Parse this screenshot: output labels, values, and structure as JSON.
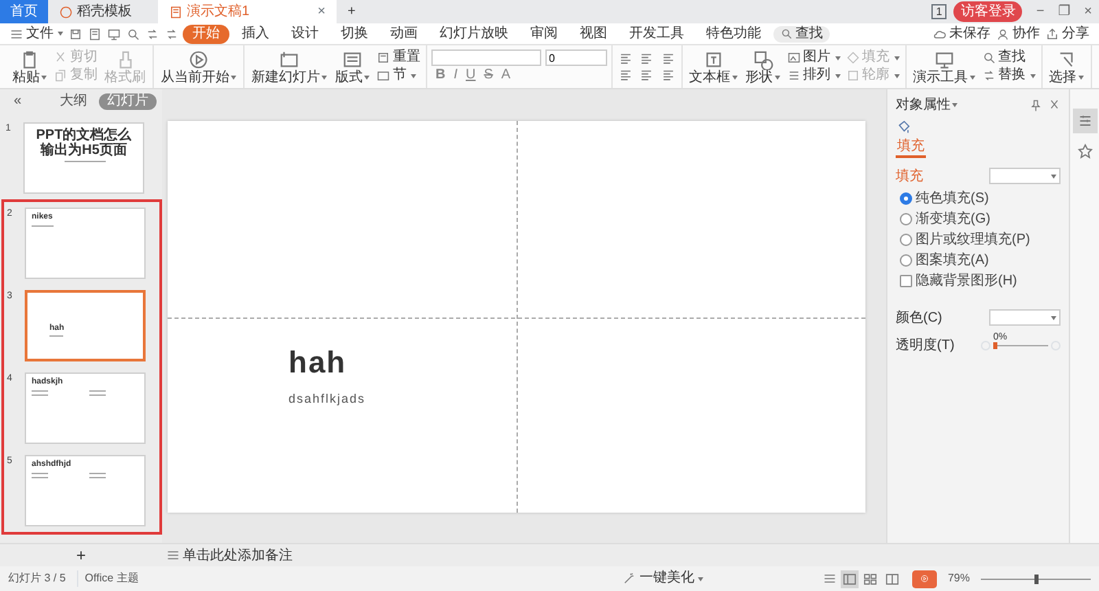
{
  "doc_tabs": [
    {
      "label": "首页",
      "kind": "home",
      "selected": false
    },
    {
      "label": "稻壳模板",
      "kind": "store",
      "selected": false
    },
    {
      "label": "演示文稿1",
      "kind": "doc",
      "selected": true
    }
  ],
  "tab_close": "×",
  "new_tab": "+",
  "account": {
    "badge": "1",
    "login": "访客登录"
  },
  "window_controls": [
    "−",
    "❐",
    "×"
  ],
  "menu": {
    "file": "文件",
    "tabs": [
      {
        "label": "开始",
        "selected": true
      },
      {
        "label": "插入",
        "selected": false
      },
      {
        "label": "设计",
        "selected": false
      },
      {
        "label": "切换",
        "selected": false
      },
      {
        "label": "动画",
        "selected": false
      },
      {
        "label": "幻灯片放映",
        "selected": false
      },
      {
        "label": "审阅",
        "selected": false
      },
      {
        "label": "视图",
        "selected": false
      },
      {
        "label": "开发工具",
        "selected": false
      },
      {
        "label": "特色功能",
        "selected": false
      }
    ],
    "search": "查找",
    "actions": [
      "未保存",
      "协作",
      "分享"
    ]
  },
  "toolbar": [
    {
      "kind": "tools",
      "items": [
        {
          "kind": "large",
          "label": "粘贴",
          "caret": true,
          "disabled": false
        },
        {
          "kind": "small",
          "label": "剪切",
          "caret": false,
          "disabled": true
        },
        {
          "kind": "small",
          "label": "复制",
          "caret": false,
          "disabled": true
        },
        {
          "kind": "large",
          "label": "格式刷",
          "caret": false,
          "disabled": true
        }
      ]
    },
    {
      "kind": "tools",
      "items": [
        {
          "kind": "large",
          "label": "从当前开始",
          "caret": true,
          "disabled": false
        }
      ]
    },
    {
      "kind": "tools",
      "items": [
        {
          "kind": "large",
          "label": "新建幻灯片",
          "caret": true,
          "disabled": false
        },
        {
          "kind": "large",
          "label": "版式",
          "caret": true,
          "disabled": false
        },
        {
          "kind": "small",
          "label": "重置",
          "caret": false,
          "disabled": false
        },
        {
          "kind": "small",
          "label": "节",
          "caret": true,
          "disabled": false
        }
      ]
    },
    {
      "kind": "font",
      "font_size": "0",
      "format": [
        "B",
        "I",
        "U",
        "S",
        "A"
      ]
    },
    {
      "kind": "paragraph"
    },
    {
      "kind": "tools",
      "items": [
        {
          "kind": "large",
          "label": "文本框",
          "caret": true,
          "disabled": false
        },
        {
          "kind": "large",
          "label": "形状",
          "caret": true,
          "disabled": false
        },
        {
          "kind": "small",
          "label": "图片",
          "caret": true,
          "disabled": false
        },
        {
          "kind": "small",
          "label": "排列",
          "caret": true,
          "disabled": false
        },
        {
          "kind": "small",
          "label": "填充",
          "caret": true,
          "disabled": true
        },
        {
          "kind": "small",
          "label": "轮廓",
          "caret": true,
          "disabled": true
        }
      ]
    },
    {
      "kind": "tools",
      "items": [
        {
          "kind": "large",
          "label": "演示工具",
          "caret": true,
          "disabled": false
        },
        {
          "kind": "small",
          "label": "查找",
          "caret": false,
          "disabled": false
        },
        {
          "kind": "small",
          "label": "替换",
          "caret": true,
          "disabled": false
        }
      ]
    },
    {
      "kind": "tools",
      "items": [
        {
          "kind": "large",
          "label": "选择",
          "caret": true,
          "disabled": false
        }
      ]
    }
  ],
  "left_panel": {
    "collapse": "«",
    "tabs": [
      {
        "label": "大纲",
        "selected": false
      },
      {
        "label": "幻灯片",
        "selected": true
      }
    ],
    "slides": [
      {
        "number": "1",
        "title": "PPT的文档怎么输出为H5页面",
        "kind": "title",
        "selected": false,
        "highlighted": false
      },
      {
        "number": "2",
        "title": "nikes",
        "kind": "heading",
        "selected": false,
        "highlighted": true
      },
      {
        "number": "3",
        "title": "hah",
        "kind": "center",
        "selected": true,
        "highlighted": true
      },
      {
        "number": "4",
        "title": "hadskjh",
        "kind": "two_column",
        "selected": false,
        "highlighted": true
      },
      {
        "number": "5",
        "title": "ahshdfhjd",
        "kind": "two_column",
        "selected": false,
        "highlighted": true
      }
    ],
    "add": "+"
  },
  "slide": {
    "title": "hah",
    "subtitle": "dsahflkjads"
  },
  "notes": "单击此处添加备注",
  "properties": {
    "title": "对象属性",
    "tab": {
      "label": "填充",
      "selected": true
    },
    "section": "填充",
    "options": [
      {
        "kind": "radio",
        "label": "纯色填充(S)",
        "checked": true
      },
      {
        "kind": "radio",
        "label": "渐变填充(G)",
        "checked": false
      },
      {
        "kind": "radio",
        "label": "图片或纹理填充(P)",
        "checked": false
      },
      {
        "kind": "radio",
        "label": "图案填充(A)",
        "checked": false
      },
      {
        "kind": "checkbox",
        "label": "隐藏背景图形(H)",
        "checked": false
      }
    ],
    "color_label": "颜色(C)",
    "transparency_label": "透明度(T)",
    "transparency": {
      "reading": "0%",
      "level": 0
    }
  },
  "side_strip": [
    {
      "kind": "properties",
      "selected": true
    },
    {
      "kind": "star",
      "selected": false
    }
  ],
  "status": {
    "slide": "幻灯片 3 / 5",
    "theme": "Office 主题",
    "beautify": "一键美化",
    "zoom": "79%",
    "zoom_slider": {
      "level": 0.5
    },
    "views": [
      {
        "kind": "normal",
        "selected": true
      },
      {
        "kind": "sorter",
        "selected": false
      },
      {
        "kind": "reading",
        "selected": false
      }
    ]
  }
}
